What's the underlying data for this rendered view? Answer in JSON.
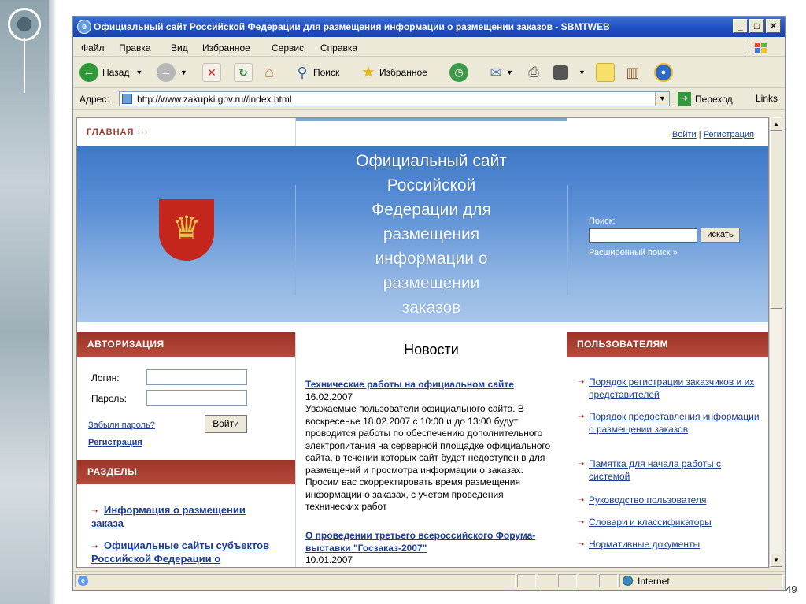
{
  "slide": {
    "page_number": "49"
  },
  "window": {
    "title": "Официальный сайт Российской Федерации для размещения информации о размещении заказов - SBMTWEB",
    "min": "_",
    "max": "□",
    "close": "✕"
  },
  "menu": [
    "Файл",
    "Правка",
    "Вид",
    "Избранное",
    "Сервис",
    "Справка"
  ],
  "toolbar": {
    "back": "Назад",
    "search": "Поиск",
    "favorites": "Избранное"
  },
  "address": {
    "label": "Адрес:",
    "url": "http://www.zakupki.gov.ru//index.html",
    "go": "Переход",
    "links": "Links"
  },
  "site": {
    "nav_main": "ГЛАВНАЯ",
    "nav_chevrons": "›››",
    "login_link": "Войти",
    "separator": "|",
    "register_link": "Регистрация",
    "hero_title_lines": [
      "Официальный сайт",
      "Российской",
      "Федерации для",
      "размещения",
      "информации о",
      "размещении",
      "заказов"
    ],
    "search_label": "Поиск:",
    "search_button": "искать",
    "search_advanced": "Расширенный поиск »",
    "auth": {
      "heading": "АВТОРИЗАЦИЯ",
      "login_label": "Логин:",
      "password_label": "Пароль:",
      "forgot": "Забыли пароль?",
      "submit": "Войти",
      "register": "Регистрация"
    },
    "sections": {
      "heading": "РАЗДЕЛЫ",
      "items": [
        {
          "label": "Информация о размещении заказа"
        },
        {
          "label": "Официальные сайты субъектов Российской Федерации о"
        }
      ]
    },
    "news": {
      "heading": "Новости",
      "items": [
        {
          "title": "Технические работы на официальном сайте",
          "date": "16.02.2007",
          "body": "Уважаемые пользователи официального сайта. В воскресенье 18.02.2007 с 10:00 и до 13:00 будут проводится работы по обеспечению дополнительного электропитания на серверной площадке официального сайта, в течении которых сайт будет недоступен в для размещений и просмотра информации о заказах. Просим вас скорректировать время размещения информации о заказах, с учетом проведения технических работ"
        },
        {
          "title": "О проведении третьего всероссийского Форума-выставки \"Госзаказ-2007\"",
          "date": "10.01.2007",
          "body": ""
        }
      ]
    },
    "users": {
      "heading": "ПОЛЬЗОВАТЕЛЯМ",
      "items": [
        {
          "label": "Порядок регистрации заказчиков и их представителей"
        },
        {
          "label": "Порядок предоставления информации о размещении заказов"
        },
        {
          "label": "Памятка для начала работы с системой"
        },
        {
          "label": "Руководство пользователя"
        },
        {
          "label": "Словари и классификаторы"
        },
        {
          "label": "Нормативные документы"
        }
      ]
    }
  },
  "status": {
    "zone": "Internet"
  },
  "colors": {
    "title_bar": "#1f4fc2",
    "section_header": "#a43a2c",
    "hero": "#5a8fd5",
    "link": "#1b3d99"
  }
}
